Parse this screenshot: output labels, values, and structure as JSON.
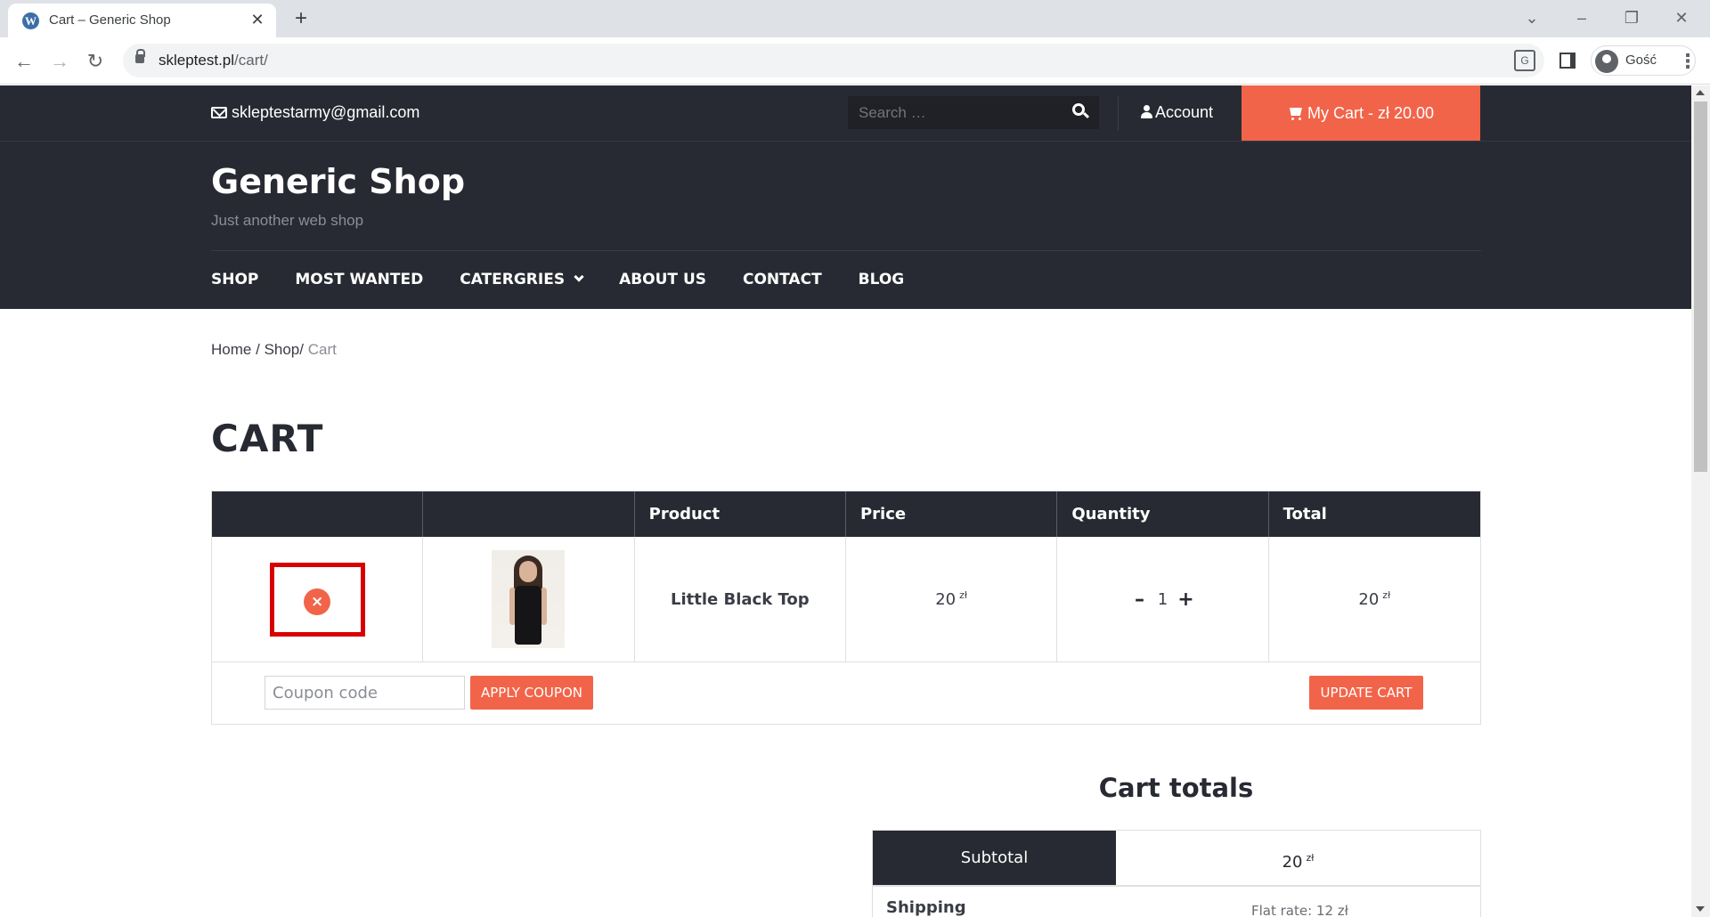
{
  "browser": {
    "tab_title": "Cart – Generic Shop",
    "url_host": "skleptest.pl",
    "url_path": "/cart/",
    "profile_name": "Gość",
    "icons": [
      "wordpress-icon",
      "close-icon",
      "plus-icon",
      "back-icon",
      "forward-icon",
      "reload-icon",
      "lock-icon",
      "translate-icon",
      "side-panel-icon",
      "profile-icon",
      "kebab-menu-icon"
    ]
  },
  "header": {
    "email": "skleptestarmy@gmail.com",
    "search_placeholder": "Search …",
    "account_label": "Account",
    "cart_label": "My Cart - zł 20.00",
    "site_title": "Generic Shop",
    "tagline": "Just another web shop",
    "accent_color": "#f26449",
    "dark_color": "#272a32"
  },
  "nav": {
    "items": [
      "SHOP",
      "MOST WANTED",
      "CATERGRIES",
      "ABOUT US",
      "CONTACT",
      "BLOG"
    ]
  },
  "breadcrumb": {
    "home": "Home",
    "sep1": "/",
    "shop": "Shop",
    "sep2": "/",
    "current": "Cart"
  },
  "page": {
    "title": "CART"
  },
  "cart": {
    "headers": [
      "",
      "",
      "Product",
      "Price",
      "Quantity",
      "Total"
    ],
    "item": {
      "remove_symbol": "×",
      "name": "Little Black Top",
      "price": "20",
      "currency": "zł",
      "qty_minus": "–",
      "quantity": "1",
      "qty_plus": "+",
      "total": "20"
    },
    "coupon_placeholder": "Coupon code",
    "apply_coupon_label": "APPLY COUPON",
    "update_cart_label": "UPDATE CART"
  },
  "totals": {
    "title": "Cart totals",
    "subtotal_label": "Subtotal",
    "subtotal_value": "20",
    "currency": "zł",
    "shipping_label": "Shipping",
    "shipping_value": "Flat rate: 12 zł"
  }
}
